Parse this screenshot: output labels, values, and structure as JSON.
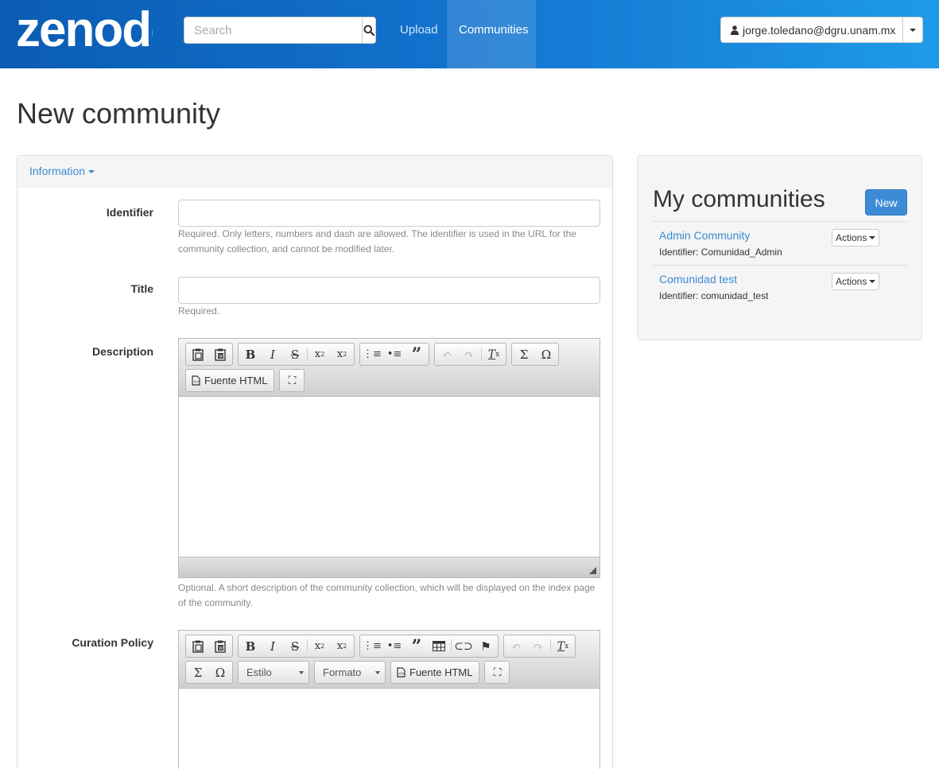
{
  "brand": {
    "logo_text": "zenodo"
  },
  "header": {
    "search_placeholder": "Search",
    "nav": [
      {
        "label": "Upload"
      },
      {
        "label": "Communities",
        "active": true
      }
    ],
    "user_email": "jorge.toledano@dgru.unam.mx"
  },
  "page": {
    "title": "New community"
  },
  "form": {
    "panel_tab": "Information",
    "identifier": {
      "label": "Identifier",
      "value": "",
      "help": "Required. Only letters, numbers and dash are allowed. The identifier is used in the URL for the community collection, and cannot be modified later."
    },
    "title": {
      "label": "Title",
      "value": "",
      "help": "Required."
    },
    "description": {
      "label": "Description",
      "help": "Optional. A short description of the community collection, which will be displayed on the index page of the community.",
      "source_button": "Fuente HTML"
    },
    "curation_policy": {
      "label": "Curation Policy",
      "style_select": "Estilo",
      "format_select": "Formato",
      "source_button": "Fuente HTML"
    }
  },
  "sidebar": {
    "title": "My communities",
    "new_button": "New",
    "communities": [
      {
        "name": "Admin Community",
        "identifier": "Identifier: Comunidad_Admin",
        "actions": "Actions"
      },
      {
        "name": "Comunidad test",
        "identifier": "Identifier: comunidad_test",
        "actions": "Actions"
      }
    ]
  }
}
